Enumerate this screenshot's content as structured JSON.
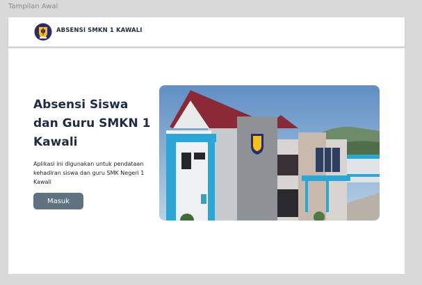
{
  "frame": {
    "label": "Tampilan Awal"
  },
  "navbar": {
    "logo_icon": "school-emblem-icon",
    "brand": "ABSENSI SMKN 1 KAWALI"
  },
  "hero": {
    "title": "Absensi Siswa dan Guru SMKN 1 Kawali",
    "description": "Aplikasi ini digunakan untuk pendataan kehadiran siswa dan guru SMK Negeri 1 Kawali",
    "button_label": "Masuk",
    "photo_icon": "school-building-photo"
  },
  "colors": {
    "accent": "#1f2a44",
    "button": "#5e7280",
    "building_trim": "#29a8d8",
    "roof": "#8b2a37"
  }
}
